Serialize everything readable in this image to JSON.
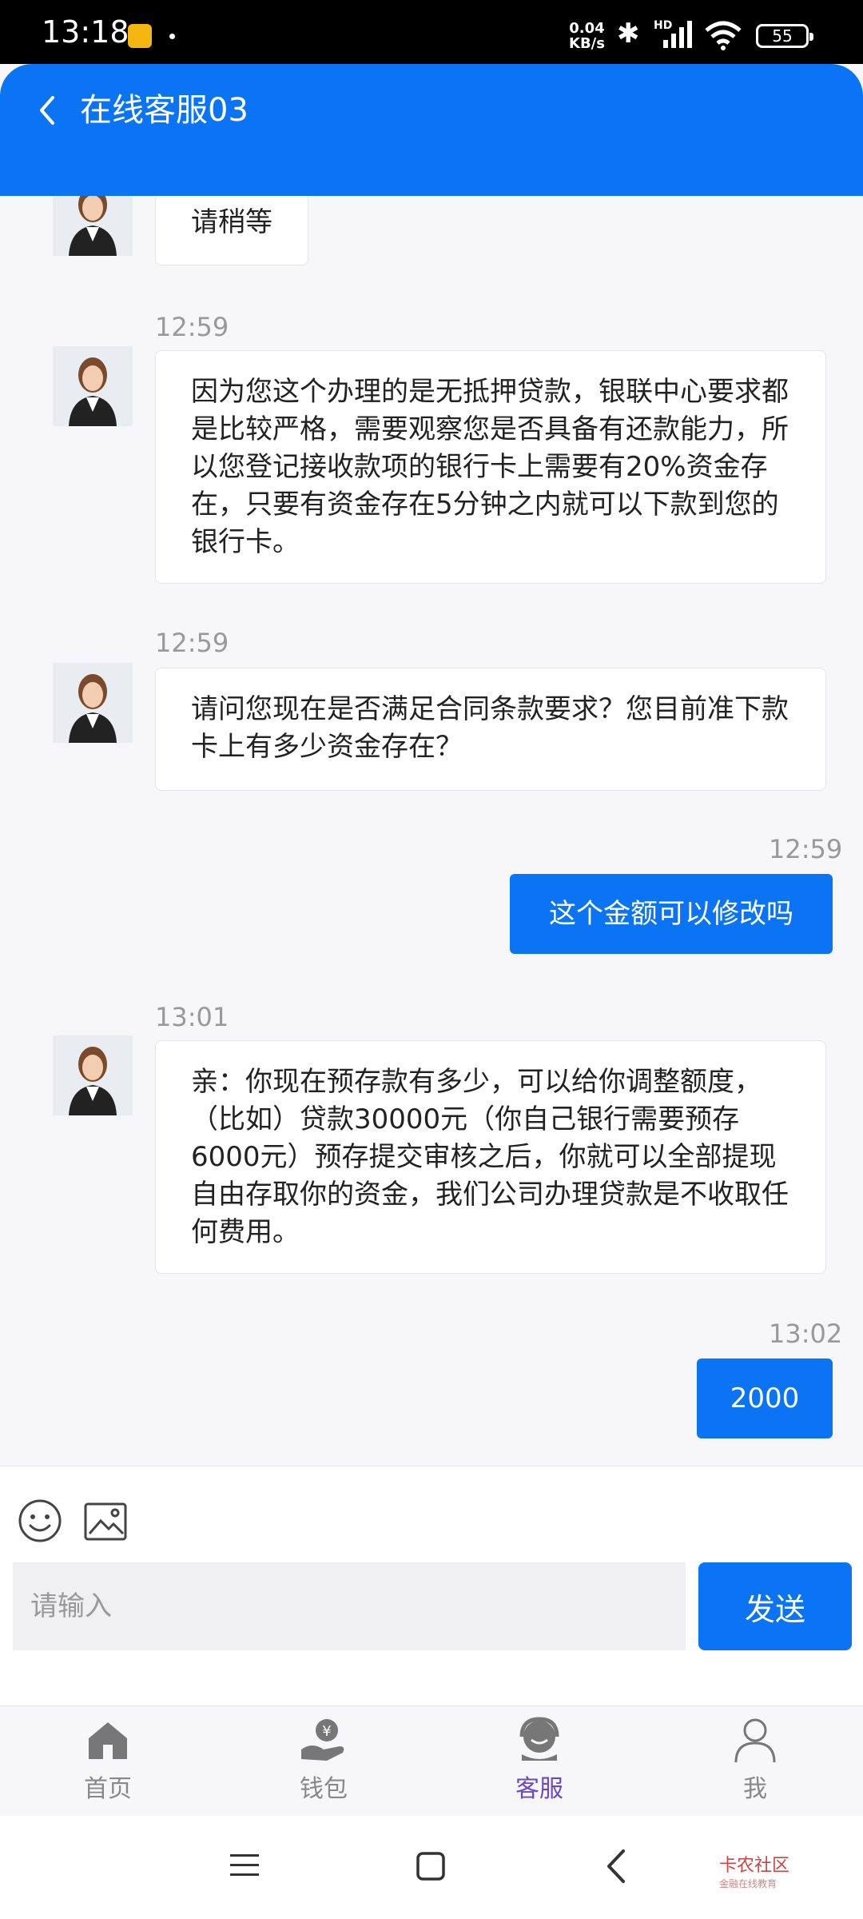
{
  "status_bar": {
    "time": "13:18",
    "net_speed_value": "0.04",
    "net_speed_unit": "KB/s",
    "hd": "HD",
    "battery": "55"
  },
  "header": {
    "title": "在线客服03"
  },
  "messages": [
    {
      "from": "agent",
      "text": "请稍等"
    },
    {
      "from": "agent",
      "time": "12:59",
      "text": "因为您这个办理的是无抵押贷款，银联中心要求都是比较严格，需要观察您是否具备有还款能力，所以您登记接收款项的银行卡上需要有20%资金存在，只要有资金存在5分钟之内就可以下款到您的银行卡。"
    },
    {
      "from": "agent",
      "time": "12:59",
      "text": "请问您现在是否满足合同条款要求？您目前准下款卡上有多少资金存在？"
    },
    {
      "from": "user",
      "time": "12:59",
      "text": "这个金额可以修改吗"
    },
    {
      "from": "agent",
      "time": "13:01",
      "text": "亲：你现在预存款有多少，可以给你调整额度，（比如）贷款30000元（你自己银行需要预存6000元）预存提交审核之后，你就可以全部提现自由存取你的资金，我们公司办理贷款是不收取任何费用。"
    },
    {
      "from": "user",
      "time": "13:02",
      "text": "2000"
    }
  ],
  "input": {
    "placeholder": "请输入",
    "send_label": "发送"
  },
  "bottom_nav": [
    {
      "label": "首页",
      "icon": "home-icon"
    },
    {
      "label": "钱包",
      "icon": "wallet-icon"
    },
    {
      "label": "客服",
      "icon": "customer-service-icon",
      "active": true
    },
    {
      "label": "我",
      "icon": "profile-icon"
    }
  ],
  "watermark": {
    "title": "卡农社区",
    "subtitle": "金融在线教育"
  },
  "colors": {
    "brand_blue": "#0a74f4",
    "active_nav": "#6b47c9"
  }
}
